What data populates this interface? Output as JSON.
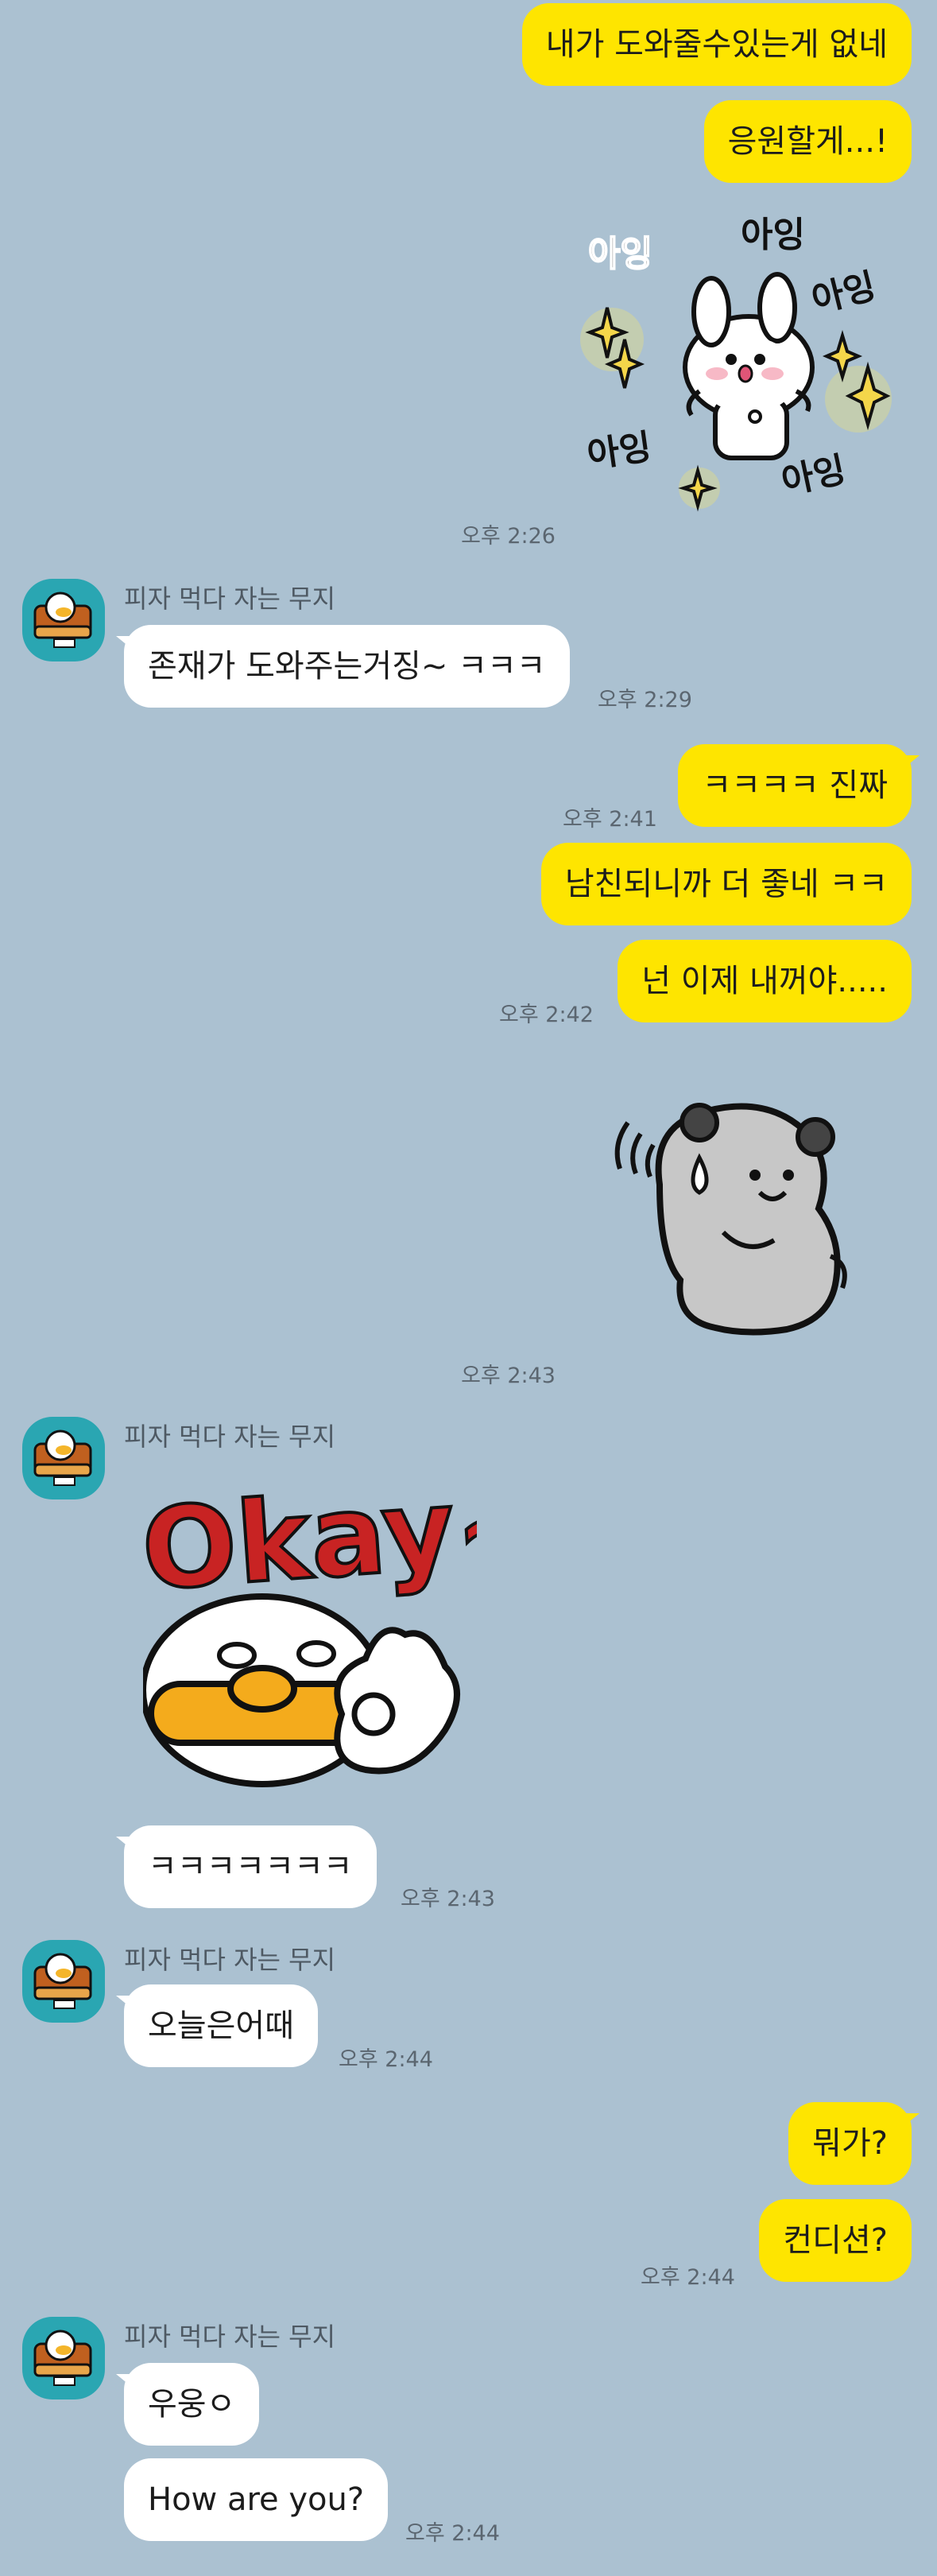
{
  "contact": {
    "name": "피자 먹다 자는 무지"
  },
  "messages": {
    "m1": {
      "text": "내가 도와줄수있는게 없네"
    },
    "m2": {
      "text": "응원할게...!"
    },
    "s1": {
      "sticker_text": "아잉",
      "time": "오후 2:26"
    },
    "m3": {
      "text": "존재가 도와주는거징~ ㅋㅋㅋ",
      "time": "오후 2:29"
    },
    "m4": {
      "text": "ㅋㅋㅋㅋ 진짜",
      "time": "오후 2:41"
    },
    "m5": {
      "text": "남친되니까 더 좋네 ㅋㅋ"
    },
    "m6": {
      "text": "넌 이제 내꺼야.....",
      "time": "오후 2:42"
    },
    "s2": {
      "time": "오후 2:43"
    },
    "s3": {
      "sticker_text": "Okay~"
    },
    "m7": {
      "text": "ㅋㅋㅋㅋㅋㅋㅋ",
      "time": "오후 2:43"
    },
    "m8": {
      "text": "오늘은어때",
      "time": "오후 2:44"
    },
    "m9": {
      "text": "뭐가?"
    },
    "m10": {
      "text": "컨디션?",
      "time": "오후 2:44"
    },
    "m11": {
      "text": "우웅ㅇ"
    },
    "m12": {
      "text": "How are you?",
      "time": "오후 2:44"
    }
  },
  "colors": {
    "background": "#abc1d1",
    "my_bubble": "#fee500",
    "their_bubble": "#ffffff"
  }
}
